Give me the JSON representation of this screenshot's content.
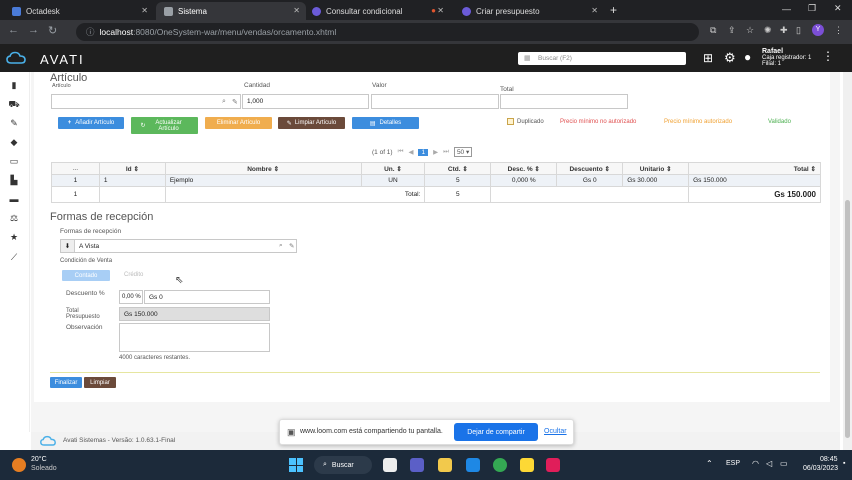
{
  "browser": {
    "tabs": [
      {
        "title": "Octadesk",
        "active": false
      },
      {
        "title": "Sistema",
        "active": true
      },
      {
        "title": "Consultar condicional",
        "active": false
      },
      {
        "title": "Criar presupuesto",
        "active": false
      }
    ],
    "url_host": "localhost",
    "url_rest": ":8080/OneSystem-war/menu/vendas/orcamento.xhtml"
  },
  "app": {
    "brand": "AVATI",
    "search_placeholder": "Buscar (F2)",
    "user_name": "Rafael",
    "user_line2": "Caja registrador: 1",
    "user_line3": "Filial: 1"
  },
  "articulo": {
    "section_title": "Artículo",
    "articulo_label": "Artículo",
    "cantidad_label": "Cantidad",
    "cantidad_value": "1,000",
    "valor_label": "Valor",
    "total_label": "Total",
    "buttons": {
      "add": "Añadir Artículo",
      "update": "Actualizar Artículo",
      "delete": "Eliminar Artículo",
      "clear": "Limpiar Artículo",
      "details": "Detalles"
    },
    "duplicado": "Duplicado",
    "precio_min_rojo": "Precio mínimo no autorizado",
    "precio_min_naranja": "Precio mínimo autorizado",
    "validado": "Validado"
  },
  "paginator": {
    "info": "(1 of 1)",
    "current_page": "1",
    "rows": "50"
  },
  "table": {
    "headers": [
      "...",
      "Id",
      "Nombre",
      "Un.",
      "Ctd.",
      "Desc. %",
      "Descuento",
      "Unitario",
      "Total"
    ],
    "rows": [
      [
        "1",
        "1",
        "Ejemplo",
        "UN",
        "5",
        "0,000 %",
        "Gs 0",
        "Gs 30.000",
        "Gs 150.000"
      ]
    ],
    "footer_count": "1",
    "footer_label": "Total:",
    "footer_qty": "5",
    "footer_total": "Gs 150.000"
  },
  "recepcion": {
    "section_title": "Formas de recepción",
    "formas_label": "Formas de recepción",
    "formas_value": "A Vista",
    "condicion_label": "Condición de Venta",
    "contado": "Contado",
    "credito": "Crédito",
    "descuento_label": "Descuento %",
    "descuento_pct": "0,00 %",
    "descuento_val": "Gs 0",
    "total_label_1": "Total",
    "total_label_2": "Presupuesto",
    "total_value": "Gs 150.000",
    "observacion_label": "Observación",
    "chars_left": "4000 caracteres restantes."
  },
  "actions": {
    "finalizar": "Finalizar",
    "limpiar": "Limpiar"
  },
  "footer": {
    "text": "Avati Sistemas - Versão: 1.0.63.1-Final"
  },
  "share_banner": {
    "text": "www.loom.com está compartiendo tu pantalla.",
    "stop": "Dejar de compartir",
    "hide": "Ocultar"
  },
  "taskbar": {
    "temp": "20°C",
    "weather": "Soleado",
    "search": "Buscar",
    "lang": "ESP",
    "time": "08:45",
    "date": "06/03/2023"
  },
  "colors": {
    "blue": "#3c8dde",
    "green": "#5cb85c",
    "orange": "#f0ad4e",
    "brown": "#6b4a3a",
    "red": "#e05050"
  }
}
